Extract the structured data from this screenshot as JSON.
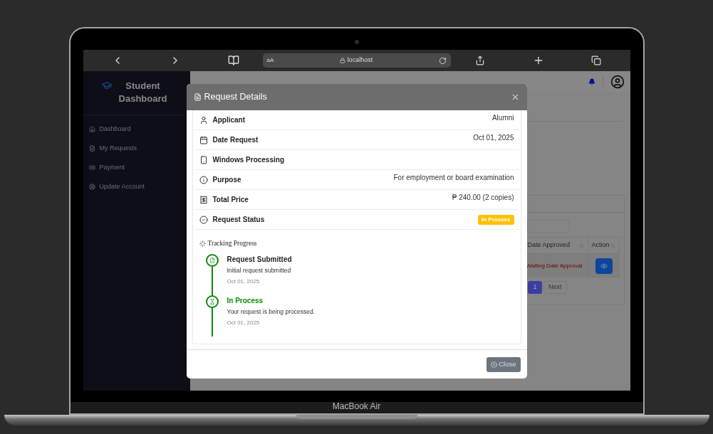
{
  "browser": {
    "text_size": "aA",
    "address": "localhost"
  },
  "sidebar": {
    "title": "Student Dashboard",
    "items": [
      {
        "label": "Dashboard"
      },
      {
        "label": "My Requests"
      },
      {
        "label": "Payment"
      },
      {
        "label": "Update Account"
      }
    ]
  },
  "page": {
    "table": {
      "columns": [
        "Date Approved",
        "Action"
      ],
      "rows": [
        {
          "date_approved": "Waiting Date Approval"
        }
      ]
    },
    "pagination": {
      "pages": [
        {
          "label": "1",
          "selected": true
        }
      ],
      "next": "Next"
    }
  },
  "modal": {
    "title": "Request Details",
    "details": [
      {
        "label": "Applicant",
        "value": "Alumni",
        "kind": "text"
      },
      {
        "label": "Date Request",
        "value": "Oct 01, 2025",
        "kind": "text"
      },
      {
        "label": "Windows Processing",
        "kind": "text"
      },
      {
        "label": "Purpose",
        "value": "For employment or board examination",
        "kind": "text"
      },
      {
        "label": "Total Price",
        "value": "₱ 240.00 (2 copies)",
        "kind": "text"
      },
      {
        "label": "Request Status",
        "value": "In Process",
        "kind": "badge"
      }
    ],
    "tracking": {
      "title": "Tracking Progress",
      "steps": [
        {
          "title": "Request Submitted",
          "description": "Initial request submitted",
          "date": "Oct 01, 2025",
          "current": false
        },
        {
          "title": "In Process",
          "description": "Your request is being processed.",
          "date": "Oct 01, 2025",
          "current": true
        }
      ]
    },
    "close": "Close"
  },
  "laptop": {
    "model": "MacBook Air"
  }
}
